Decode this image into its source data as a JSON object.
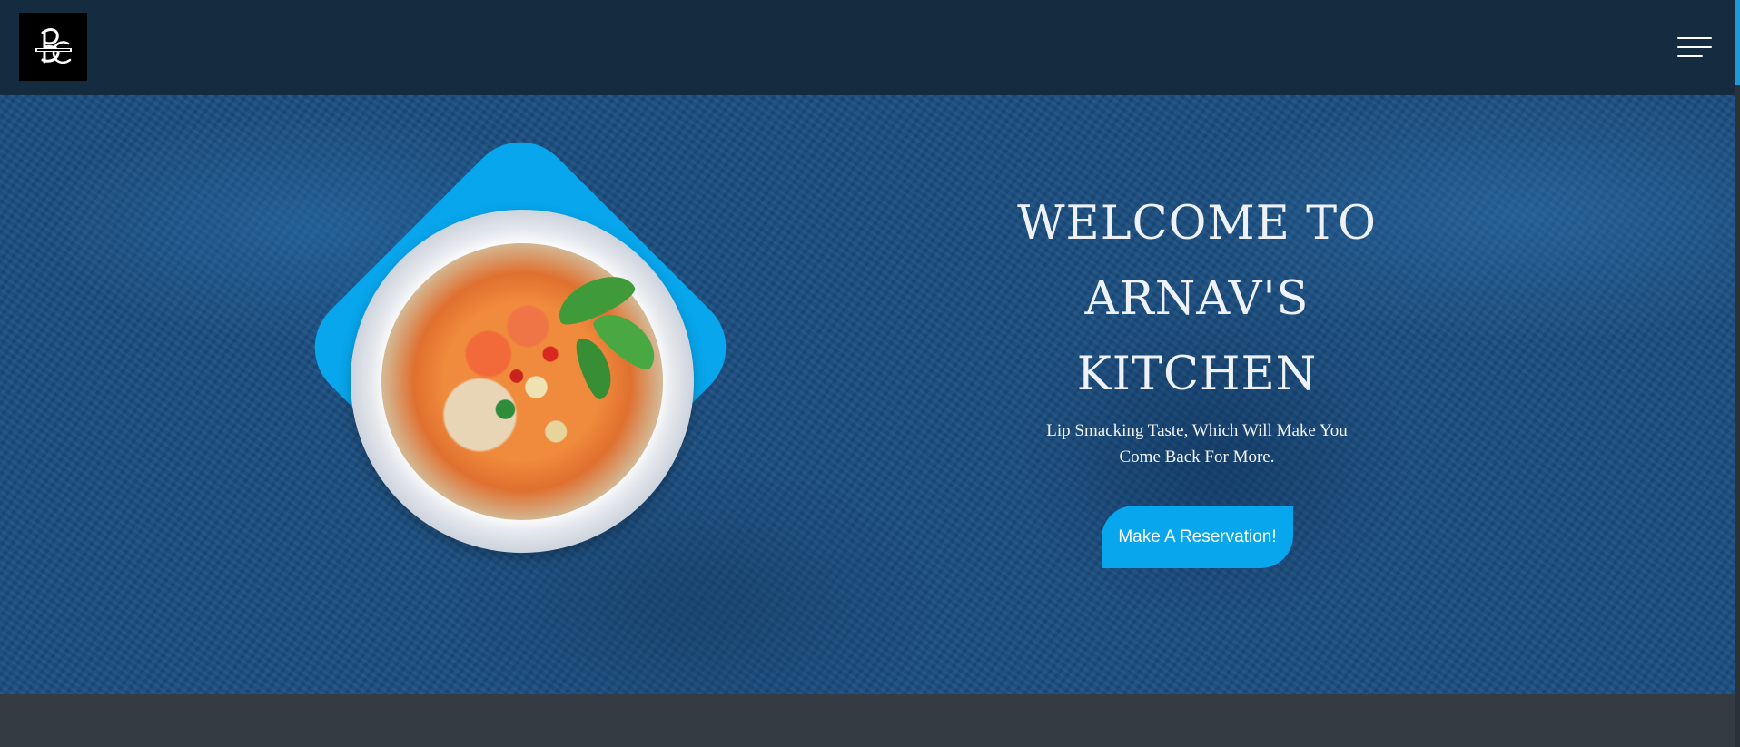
{
  "header": {
    "logo_alt": "BC logo",
    "menu_icon": "hamburger-menu-icon"
  },
  "hero": {
    "title_line1": "WELCOME TO",
    "title_line2": "ARNAV'S",
    "title_line3": "KITCHEN",
    "tagline_line1": "Lip Smacking Taste, Which Will Make You",
    "tagline_line2": "Come Back For More.",
    "cta_label": "Make A Reservation!",
    "image_alt": "Bowl of noodle soup with shrimp"
  },
  "colors": {
    "navbar": "#142b40",
    "hero_background": "#1b4e80",
    "accent": "#08a6ec",
    "footer_band": "#353b42",
    "text": "#eef2f6"
  }
}
